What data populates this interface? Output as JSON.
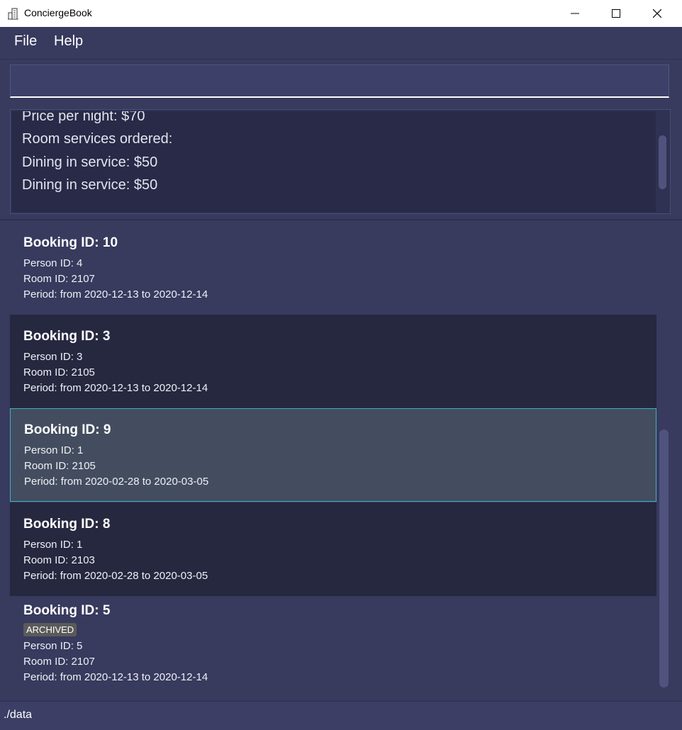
{
  "window": {
    "title": "ConciergeBook",
    "icon": "building-icon"
  },
  "menu": {
    "file": "File",
    "help": "Help"
  },
  "command": {
    "value": ""
  },
  "result": {
    "lines": [
      "Price per night: $70",
      "Room services ordered:",
      "Dining in service: $50",
      "Dining in service: $50"
    ]
  },
  "bookings": [
    {
      "title": "Booking ID: 10",
      "person": "Person ID: 4",
      "room": "Room ID: 2107",
      "period": "Period: from 2020-12-13 to 2020-12-14"
    },
    {
      "title": "Booking ID: 3",
      "person": "Person ID: 3",
      "room": "Room ID: 2105",
      "period": "Period: from 2020-12-13 to 2020-12-14"
    },
    {
      "title": "Booking ID: 9",
      "person": "Person ID: 1",
      "room": "Room ID: 2105",
      "period": "Period: from 2020-02-28 to 2020-03-05",
      "selected": true
    },
    {
      "title": "Booking ID: 8",
      "person": "Person ID: 1",
      "room": "Room ID: 2103",
      "period": "Period: from 2020-02-28 to 2020-03-05"
    },
    {
      "title": "Booking ID: 5",
      "badge": "ARCHIVED",
      "person": "Person ID: 5",
      "room": "Room ID: 2107",
      "period": "Period: from 2020-12-13 to 2020-12-14"
    }
  ],
  "status": {
    "path": "./data"
  },
  "colors": {
    "background": "#383a5e",
    "card_dark": "#262840",
    "selected": "#434d5f",
    "selected_border": "#3fb0c4",
    "badge": "#5a5a5a"
  }
}
